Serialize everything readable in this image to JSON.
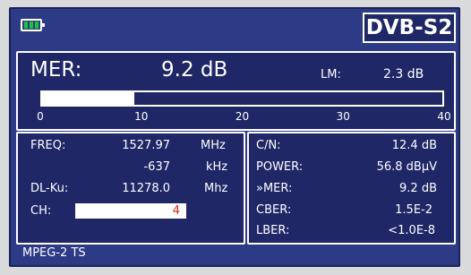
{
  "header": {
    "standard": "DVB-S2",
    "battery_icon": "battery-icon",
    "battery_color": "#19c23b"
  },
  "mer": {
    "label": "MER:",
    "value": "9.2 dB",
    "lm_label": "LM:",
    "lm_value": "2.3 dB",
    "bar_level": 9.2,
    "scale_min": 0,
    "scale_max": 40,
    "ticks": [
      "0",
      "10",
      "20",
      "30",
      "40"
    ]
  },
  "tuning": {
    "freq_label": "FREQ:",
    "freq_value": "1527.97",
    "freq_unit": "MHz",
    "offset_value": "-637",
    "offset_unit": "kHz",
    "dlku_label": "DL-Ku:",
    "dlku_value": "11278.0",
    "dlku_unit": "Mhz",
    "ch_label": "CH:",
    "ch_value": "4"
  },
  "measurements": {
    "cn_label": "C/N:",
    "cn_value": "12.4 dB",
    "power_label": "POWER:",
    "power_value": "56.8 dBµV",
    "mer_label": "»MER:",
    "mer_value": "9.2 dB",
    "cber_label": "CBER:",
    "cber_value": "1.5E-2",
    "lber_label": "LBER:",
    "lber_value": "<1.0E-8"
  },
  "footer": {
    "stream": "MPEG-2 TS"
  },
  "colors": {
    "background": "#2d3a86",
    "panel": "#1f2767",
    "ch_text": "#d8261d"
  }
}
